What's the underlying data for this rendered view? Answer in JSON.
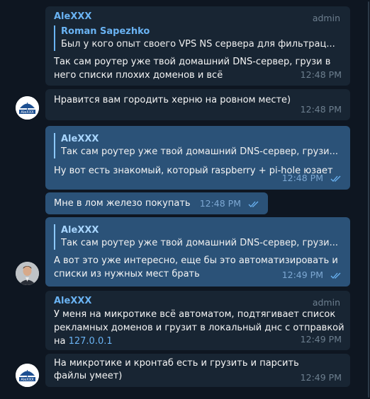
{
  "messages": [
    {
      "sender": "AleXXX",
      "badge": "admin",
      "quote": {
        "name": "Roman Sapezhko",
        "text": "Был у кого опыт своего VPS NS сервера для фильтрац..."
      },
      "text": "Так сам роутер уже твой домашний DNS-сервер, грузи в него списки плохих доменов и всё",
      "time": "12:48 PM"
    },
    {
      "text": "Нравится вам городить херню на ровном месте)",
      "time": "12:48 PM"
    },
    {
      "quote": {
        "name": "AleXXX",
        "text": "Так сам роутер уже твой домашний DNS-сервер, грузи..."
      },
      "text": "Ну вот есть знакомый, который raspberry + pi-hole юзает",
      "time": "12:48 PM"
    },
    {
      "text": "Мне в лом железо покупать",
      "time": "12:48 PM"
    },
    {
      "quote": {
        "name": "AleXXX",
        "text": "Так сам роутер уже твой домашний DNS-сервер, грузи..."
      },
      "text": "А вот это уже интересно, еще бы это автоматизировать и списки из нужных мест брать",
      "time": "12:49 PM"
    },
    {
      "sender": "AleXXX",
      "badge": "admin",
      "text": "У меня на микротике всё автоматом, подтягивает список рекламных доменов и грузит в локальный днс с отправкой на ",
      "link": "127.0.0.1",
      "time": "12:49 PM"
    },
    {
      "text": "На микротике и кронтаб есть и грузить и парсить файлы умеет)",
      "time": "12:49 PM"
    }
  ],
  "avatars": {
    "alexxx_label": "AleXXX"
  },
  "colors": {
    "background": "#0e1621",
    "incoming_bubble": "#182533",
    "outgoing_bubble": "#2b5278",
    "accent": "#6ab3f3"
  }
}
